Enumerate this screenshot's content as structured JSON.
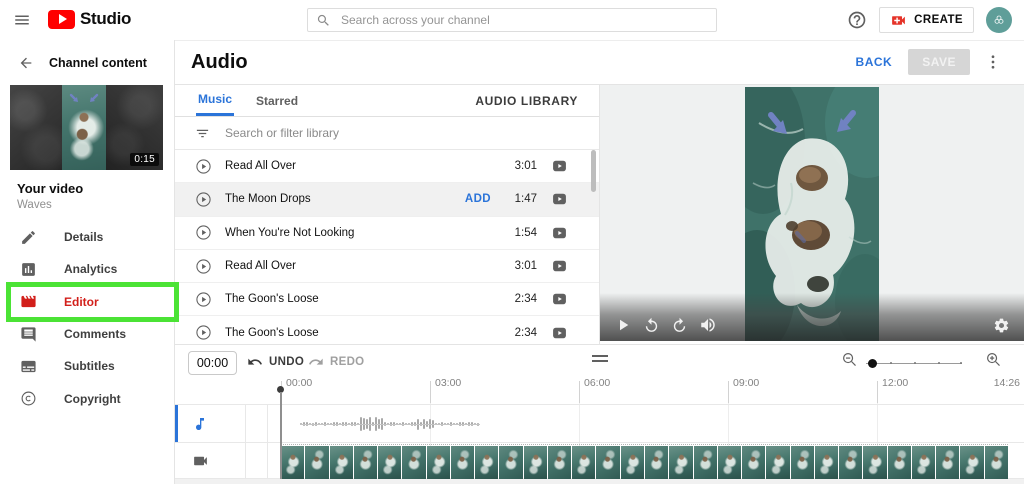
{
  "topbar": {
    "brand": "Studio",
    "search_placeholder": "Search across your channel",
    "create_label": "CREATE"
  },
  "sidebar": {
    "back_label": "Channel content",
    "video_duration_badge": "0:15",
    "video_title": "Your video",
    "video_subtitle": "Waves",
    "items": [
      {
        "label": "Details",
        "icon": "pencil-icon",
        "active": false
      },
      {
        "label": "Analytics",
        "icon": "bar-chart-icon",
        "active": false
      },
      {
        "label": "Editor",
        "icon": "film-icon",
        "active": true,
        "highlighted": true
      },
      {
        "label": "Comments",
        "icon": "comment-icon",
        "active": false
      },
      {
        "label": "Subtitles",
        "icon": "subtitles-icon",
        "active": false
      },
      {
        "label": "Copyright",
        "icon": "copyright-icon",
        "active": false
      }
    ]
  },
  "audio_panel": {
    "title": "Audio",
    "back_label": "BACK",
    "save_label": "SAVE",
    "tabs": [
      {
        "label": "Music",
        "active": true
      },
      {
        "label": "Starred",
        "active": false
      }
    ],
    "library_link": "AUDIO LIBRARY",
    "filter_placeholder": "Search or filter library",
    "tracks": [
      {
        "title": "Read All Over",
        "duration": "3:01"
      },
      {
        "title": "The Moon Drops",
        "duration": "1:47",
        "add_label": "ADD",
        "hovered": true
      },
      {
        "title": "When You're Not Looking",
        "duration": "1:54"
      },
      {
        "title": "Read All Over",
        "duration": "3:01"
      },
      {
        "title": "The Goon's Loose",
        "duration": "2:34"
      },
      {
        "title": "The Goon's Loose",
        "duration": "2:34"
      }
    ]
  },
  "preview": {
    "controls": [
      "play-icon",
      "replay-10-icon",
      "forward-10-icon",
      "volume-icon",
      "settings-gear-icon"
    ]
  },
  "timeline": {
    "current_time": "00:00",
    "undo_label": "UNDO",
    "redo_label": "REDO",
    "ruler_ticks": [
      "00:00",
      "03:00",
      "06:00",
      "09:00",
      "12:00",
      "14:26"
    ],
    "tracks": [
      {
        "icon": "music-note-icon",
        "selected": true
      },
      {
        "icon": "camera-icon",
        "selected": false
      }
    ]
  },
  "colors": {
    "accent_blue": "#2b74d9",
    "brand_red": "#ff0000",
    "editor_red": "#d21f1a",
    "highlight_green": "#4be335",
    "avatar_teal": "#5f9e99"
  }
}
